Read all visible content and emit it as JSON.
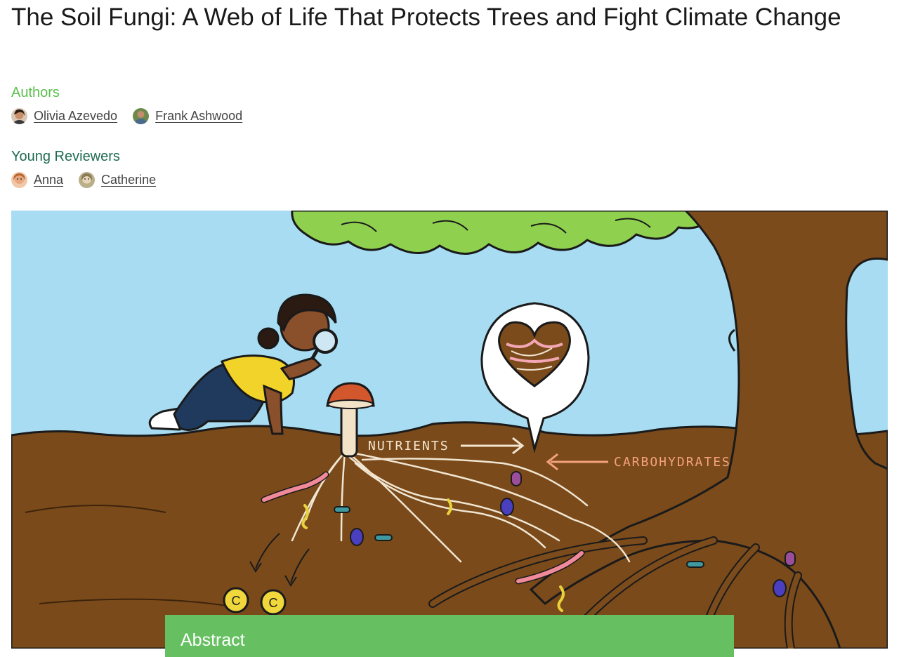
{
  "article": {
    "title": "The Soil Fungi: A Web of Life That Protects Trees and Fight Climate Change"
  },
  "authors": {
    "heading": "Authors",
    "people": [
      {
        "name": "Olivia Azevedo"
      },
      {
        "name": "Frank Ashwood"
      }
    ]
  },
  "reviewers": {
    "heading": "Young Reviewers",
    "people": [
      {
        "name": "Anna"
      },
      {
        "name": "Catherine"
      }
    ]
  },
  "figure": {
    "nutrients_label": "NUTRIENTS",
    "carbohydrates_label": "CARBOHYDRATES",
    "carbon_symbol": "C"
  },
  "abstract": {
    "heading": "Abstract"
  },
  "colors": {
    "authors_heading": "#5cbf4d",
    "reviewers_heading": "#1e6b52",
    "abstract_bar": "#66c061",
    "sky": "#a8dcf2",
    "soil": "#7a4a1b",
    "tree": "#7b4b1c",
    "leaves": "#8fd14f",
    "nutrients_label": "#f3e6d0",
    "carbohydrates_label": "#f4a27a"
  }
}
